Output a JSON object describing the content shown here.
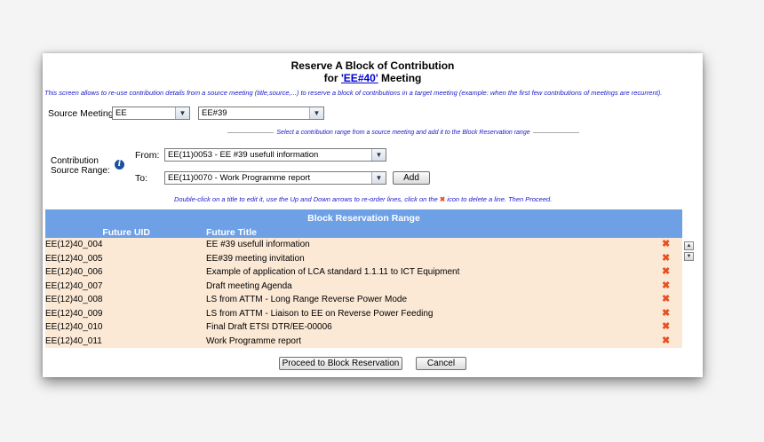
{
  "title": {
    "line1": "Reserve A Block of Contribution",
    "line2_prefix": "for ",
    "meeting_link": "'EE#40'",
    "line2_suffix": " Meeting"
  },
  "description": "This screen allows to re-use contribution details from a source meeting (title,source,...) to reserve a block of contributions in a target meeting (example: when the first few contributions of meetings are recurrent).",
  "source_meeting": {
    "label": "Source Meeting:",
    "group_value": "EE",
    "meeting_value": "EE#39"
  },
  "separator_text": "Select a contribution range from a source meeting and add it to the Block Reservation range",
  "range": {
    "label_line1": "Contribution",
    "label_line2": "Source Range:",
    "info_icon": "i",
    "from_label": "From:",
    "from_value": "EE(11)0053 - EE #39 usefull information",
    "to_label": "To:",
    "to_value": "EE(11)0070 - Work Programme report",
    "add_label": "Add"
  },
  "hint": {
    "before": "Double-click on a title to edit it, use the Up and Down arrows to re-order lines, click on the ",
    "icon": "✖",
    "after": " icon to delete a line. Then Proceed."
  },
  "table": {
    "caption": "Block Reservation Range",
    "col_uid": "Future UID",
    "col_title": "Future Title",
    "rows": [
      {
        "uid": "EE(12)40_004",
        "title": "EE #39 usefull information"
      },
      {
        "uid": "EE(12)40_005",
        "title": "EE#39 meeting invitation"
      },
      {
        "uid": "EE(12)40_006",
        "title": "Example of application of LCA standard 1.1.11 to ICT Equipment"
      },
      {
        "uid": "EE(12)40_007",
        "title": "Draft meeting Agenda"
      },
      {
        "uid": "EE(12)40_008",
        "title": "LS from ATTM - Long Range Reverse Power Mode"
      },
      {
        "uid": "EE(12)40_009",
        "title": "LS from ATTM - Liaison to EE on Reverse Power Feeding"
      },
      {
        "uid": "EE(12)40_010",
        "title": "Final Draft ETSI DTR/EE-00006"
      },
      {
        "uid": "EE(12)40_011",
        "title": "Work Programme report"
      }
    ],
    "delete_icon": "✖",
    "up_icon": "▲",
    "down_icon": "▼"
  },
  "buttons": {
    "proceed": "Proceed to Block Reservation",
    "cancel": "Cancel"
  },
  "select_arrow": "▼"
}
